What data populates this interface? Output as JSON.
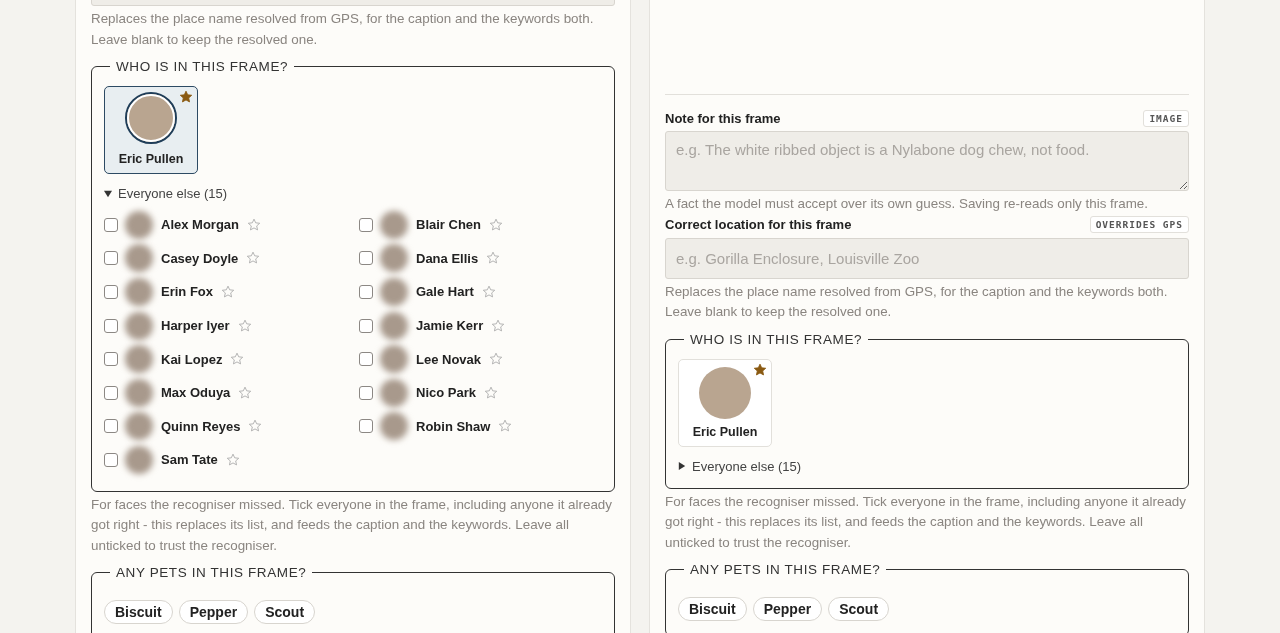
{
  "columns": [
    {
      "location": {
        "hint": "Replaces the place name resolved from GPS, for the caption and the keywords both. Leave blank to keep the resolved one."
      },
      "people": {
        "legend": "WHO IS IN THIS FRAME?",
        "featured": [
          {
            "name": "Eric Pullen",
            "selected": true,
            "starred": true
          }
        ],
        "others": {
          "label": "Everyone else (15)",
          "expanded": true,
          "people": [
            {
              "name": "Alex Morgan",
              "checked": false,
              "starred": false
            },
            {
              "name": "Blair Chen",
              "checked": false,
              "starred": false
            },
            {
              "name": "Casey Doyle",
              "checked": false,
              "starred": false
            },
            {
              "name": "Dana Ellis",
              "checked": false,
              "starred": false
            },
            {
              "name": "Erin Fox",
              "checked": false,
              "starred": false
            },
            {
              "name": "Gale Hart",
              "checked": false,
              "starred": false
            },
            {
              "name": "Harper Iyer",
              "checked": false,
              "starred": false
            },
            {
              "name": "Jamie Kerr",
              "checked": false,
              "starred": false
            },
            {
              "name": "Kai Lopez",
              "checked": false,
              "starred": false
            },
            {
              "name": "Lee Novak",
              "checked": false,
              "starred": false
            },
            {
              "name": "Max Oduya",
              "checked": false,
              "starred": false
            },
            {
              "name": "Nico Park",
              "checked": false,
              "starred": false
            },
            {
              "name": "Quinn Reyes",
              "checked": false,
              "starred": false
            },
            {
              "name": "Robin Shaw",
              "checked": false,
              "starred": false
            },
            {
              "name": "Sam Tate",
              "checked": false,
              "starred": false
            }
          ]
        },
        "hint": "For faces the recogniser missed. Tick everyone in the frame, including anyone it already got right - this replaces its list, and feeds the caption and the keywords. Leave all unticked to trust the recogniser."
      },
      "pets": {
        "legend": "ANY PETS IN THIS FRAME?",
        "items": [
          {
            "name": "Biscuit"
          },
          {
            "name": "Pepper"
          },
          {
            "name": "Scout"
          }
        ]
      }
    },
    {
      "note": {
        "label": "Note for this frame",
        "badge": "IMAGE",
        "placeholder": "e.g. The white ribbed object is a Nylabone dog chew, not food.",
        "hint": "A fact the model must accept over its own guess. Saving re-reads only this frame."
      },
      "location": {
        "label": "Correct location for this frame",
        "badge": "OVERRIDES GPS",
        "placeholder": "e.g. Gorilla Enclosure, Louisville Zoo",
        "hint": "Replaces the place name resolved from GPS, for the caption and the keywords both. Leave blank to keep the resolved one."
      },
      "people": {
        "legend": "WHO IS IN THIS FRAME?",
        "featured": [
          {
            "name": "Eric Pullen",
            "selected": false,
            "starred": true
          }
        ],
        "others": {
          "label": "Everyone else (15)",
          "expanded": false
        },
        "hint": "For faces the recogniser missed. Tick everyone in the frame, including anyone it already got right - this replaces its list, and feeds the caption and the keywords. Leave all unticked to trust the recogniser."
      },
      "pets": {
        "legend": "ANY PETS IN THIS FRAME?",
        "items": [
          {
            "name": "Biscuit"
          },
          {
            "name": "Pepper"
          },
          {
            "name": "Scout"
          }
        ]
      }
    }
  ]
}
